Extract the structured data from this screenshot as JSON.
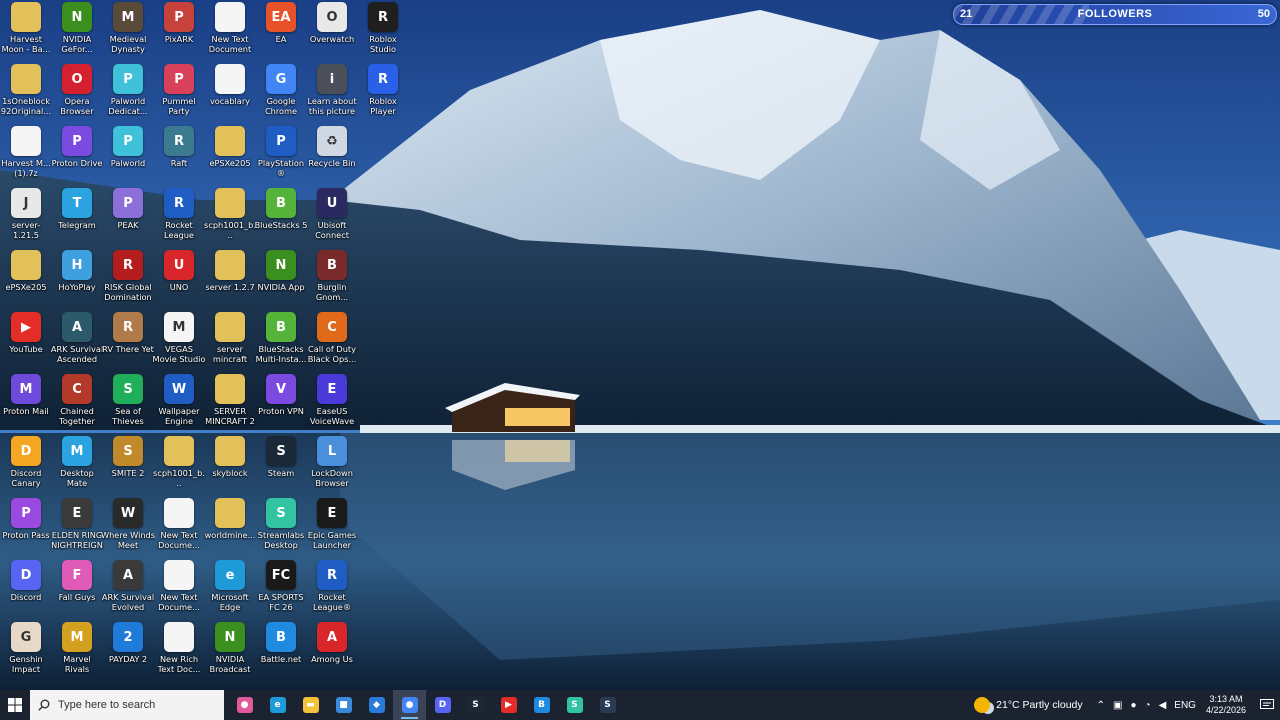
{
  "desktop": {
    "icons": [
      {
        "label": "Harvest Moon - Ba...",
        "color": "#e3c15a",
        "sym": ""
      },
      {
        "label": "NVIDIA GeFor...",
        "color": "#3a8f1e",
        "sym": "N"
      },
      {
        "label": "Medieval Dynasty",
        "color": "#5a4a3a",
        "sym": "M"
      },
      {
        "label": "PixARK",
        "color": "#c6423a",
        "sym": "P"
      },
      {
        "label": "New Text Document",
        "color": "#f5f5f5",
        "sym": ""
      },
      {
        "label": "EA",
        "color": "#e8522a",
        "sym": "EA"
      },
      {
        "label": "Overwatch",
        "color": "#e8e8e8",
        "sym": "O"
      },
      {
        "label": "Roblox Studio",
        "color": "#1f1f1f",
        "sym": "R"
      },
      {
        "label": "1sOneblock 92Original...",
        "color": "#e3c15a",
        "sym": ""
      },
      {
        "label": "Opera Browser",
        "color": "#d4202f",
        "sym": "O"
      },
      {
        "label": "Palworld Dedicat...",
        "color": "#3ec1d9",
        "sym": "P"
      },
      {
        "label": "Pummel Party",
        "color": "#d9415a",
        "sym": "P"
      },
      {
        "label": "vocablary",
        "color": "#f5f5f5",
        "sym": ""
      },
      {
        "label": "Google Chrome",
        "color": "#4285f4",
        "sym": "G"
      },
      {
        "label": "Learn about this picture",
        "color": "#4a4f5a",
        "sym": "i"
      },
      {
        "label": "Roblox Player",
        "color": "#2a60e8",
        "sym": "R"
      },
      {
        "label": "Harvest M... (1).7z",
        "color": "#f5f5f5",
        "sym": ""
      },
      {
        "label": "Proton Drive",
        "color": "#7b4ae0",
        "sym": "P"
      },
      {
        "label": "Palworld",
        "color": "#3ec1d9",
        "sym": "P"
      },
      {
        "label": "Raft",
        "color": "#3b7a8f",
        "sym": "R"
      },
      {
        "label": "ePSXe205",
        "color": "#e3c15a",
        "sym": ""
      },
      {
        "label": "PlayStation® Accessories",
        "color": "#1f5cc4",
        "sym": "P"
      },
      {
        "label": "Recycle Bin",
        "color": "#cfd8e3",
        "sym": "♻"
      },
      {
        "label": "server-1.21.5",
        "color": "#e8e8e8",
        "sym": "J"
      },
      {
        "label": "Telegram",
        "color": "#2aa3e0",
        "sym": "T"
      },
      {
        "label": "PEAK",
        "color": "#8c6fd9",
        "sym": "P"
      },
      {
        "label": "Rocket League",
        "color": "#1f5cc4",
        "sym": "R"
      },
      {
        "label": "scph1001_b...",
        "color": "#e3c15a",
        "sym": ""
      },
      {
        "label": "BlueStacks 5",
        "color": "#56b33a",
        "sym": "B"
      },
      {
        "label": "Ubisoft Connect",
        "color": "#2a2a60",
        "sym": "U"
      },
      {
        "label": "ePSXe205",
        "color": "#e3c15a",
        "sym": ""
      },
      {
        "label": "HoYoPlay",
        "color": "#3fa0e0",
        "sym": "H"
      },
      {
        "label": "RISK Global Domination",
        "color": "#b31d1d",
        "sym": "R"
      },
      {
        "label": "UNO",
        "color": "#d8262a",
        "sym": "U"
      },
      {
        "label": "server 1.2.7",
        "color": "#e3c15a",
        "sym": ""
      },
      {
        "label": "NVIDIA App",
        "color": "#3a8f1e",
        "sym": "N"
      },
      {
        "label": "Burglin Gnom...",
        "color": "#7a2a2a",
        "sym": "B"
      },
      {
        "label": "YouTube",
        "color": "#e52d27",
        "sym": "▶"
      },
      {
        "label": "ARK Survival Ascended",
        "color": "#2c5a6a",
        "sym": "A"
      },
      {
        "label": "RV There Yet",
        "color": "#b07a4a",
        "sym": "R"
      },
      {
        "label": "VEGAS Movie Studio 14 Pl...",
        "color": "#f5f5f5",
        "sym": "M"
      },
      {
        "label": "server mincraft",
        "color": "#e3c15a",
        "sym": ""
      },
      {
        "label": "BlueStacks Multi-Insta...",
        "color": "#56b33a",
        "sym": "B"
      },
      {
        "label": "Call of Duty Black Ops...",
        "color": "#e06a1a",
        "sym": "C"
      },
      {
        "label": "Proton Mail",
        "color": "#6d4ad9",
        "sym": "M"
      },
      {
        "label": "Chained Together",
        "color": "#b33a2a",
        "sym": "C"
      },
      {
        "label": "Sea of Thieves",
        "color": "#1fae5a",
        "sym": "S"
      },
      {
        "label": "Wallpaper Engine",
        "color": "#1f5cc4",
        "sym": "W"
      },
      {
        "label": "SERVER MINCRAFT 2",
        "color": "#e3c15a",
        "sym": ""
      },
      {
        "label": "Proton VPN",
        "color": "#7b4ae0",
        "sym": "V"
      },
      {
        "label": "EaseUS VoiceWave",
        "color": "#4a3ad9",
        "sym": "E"
      },
      {
        "label": "Discord Canary",
        "color": "#f5a623",
        "sym": "D"
      },
      {
        "label": "Desktop Mate",
        "color": "#2aa3e0",
        "sym": "M"
      },
      {
        "label": "SMITE 2",
        "color": "#c08a2a",
        "sym": "S"
      },
      {
        "label": "scph1001_b...",
        "color": "#e3c15a",
        "sym": ""
      },
      {
        "label": "skyblock",
        "color": "#e3c15a",
        "sym": ""
      },
      {
        "label": "Steam",
        "color": "#1b2838",
        "sym": "S"
      },
      {
        "label": "LockDown Browser",
        "color": "#4a8fd9",
        "sym": "L"
      },
      {
        "label": "Proton Pass",
        "color": "#9a4ae0",
        "sym": "P"
      },
      {
        "label": "ELDEN RING NIGHTREIGN",
        "color": "#3a3a3a",
        "sym": "E"
      },
      {
        "label": "Where Winds Meet",
        "color": "#2a2a2a",
        "sym": "W"
      },
      {
        "label": "New Text Docume...",
        "color": "#f5f5f5",
        "sym": ""
      },
      {
        "label": "worldmine...",
        "color": "#e3c15a",
        "sym": ""
      },
      {
        "label": "Streamlabs Desktop",
        "color": "#31c3a2",
        "sym": "S"
      },
      {
        "label": "Epic Games Launcher",
        "color": "#1a1a1a",
        "sym": "E"
      },
      {
        "label": "Discord",
        "color": "#5865f2",
        "sym": "D"
      },
      {
        "label": "Fall Guys",
        "color": "#e05ab8",
        "sym": "F"
      },
      {
        "label": "ARK Survival Evolved",
        "color": "#3a3a3a",
        "sym": "A"
      },
      {
        "label": "New Text Docume...",
        "color": "#f5f5f5",
        "sym": ""
      },
      {
        "label": "Microsoft Edge",
        "color": "#1f9ad9",
        "sym": "e"
      },
      {
        "label": "EA SPORTS FC 26",
        "color": "#1a1a1a",
        "sym": "FC"
      },
      {
        "label": "Rocket League®",
        "color": "#1f5cc4",
        "sym": "R"
      },
      {
        "label": "Genshin Impact",
        "color": "#e8d8c8",
        "sym": "G"
      },
      {
        "label": "Marvel Rivals",
        "color": "#d4a020",
        "sym": "M"
      },
      {
        "label": "PAYDAY 2",
        "color": "#1f7ad9",
        "sym": "2"
      },
      {
        "label": "New Rich Text Doc...",
        "color": "#f5f5f5",
        "sym": ""
      },
      {
        "label": "NVIDIA Broadcast",
        "color": "#3a8f1e",
        "sym": "N"
      },
      {
        "label": "Battle.net",
        "color": "#1f8ae0",
        "sym": "B"
      },
      {
        "label": "Among Us",
        "color": "#d8262a",
        "sym": "A"
      }
    ]
  },
  "followers_widget": {
    "current": "21",
    "title": "FOLLOWERS",
    "goal": "50",
    "progress_fraction": 0.42
  },
  "taskbar": {
    "search_placeholder": "Type here to search",
    "apps": [
      {
        "name": "app-1",
        "color": "#e05a9a",
        "sym": "●"
      },
      {
        "name": "edge",
        "color": "#1f9ad9",
        "sym": "e"
      },
      {
        "name": "file-explorer",
        "color": "#f2c33a",
        "sym": "▬"
      },
      {
        "name": "store",
        "color": "#3a8ad9",
        "sym": "■"
      },
      {
        "name": "app-5",
        "color": "#2a7ad9",
        "sym": "◆"
      },
      {
        "name": "chrome",
        "color": "#4285f4",
        "sym": "●",
        "active": true
      },
      {
        "name": "discord",
        "color": "#5865f2",
        "sym": "D"
      },
      {
        "name": "steam",
        "color": "#1b2838",
        "sym": "S"
      },
      {
        "name": "youtube",
        "color": "#e52d27",
        "sym": "▶"
      },
      {
        "name": "battle-net",
        "color": "#1f8ae0",
        "sym": "B"
      },
      {
        "name": "streamlabs",
        "color": "#31c3a2",
        "sym": "S"
      },
      {
        "name": "steam-2",
        "color": "#2a3a55",
        "sym": "S"
      }
    ],
    "weather": {
      "temp": "21°C",
      "condition": "Partly cloudy"
    },
    "language": "ENG",
    "time": "3:13 AM",
    "date": "4/22/2026"
  }
}
